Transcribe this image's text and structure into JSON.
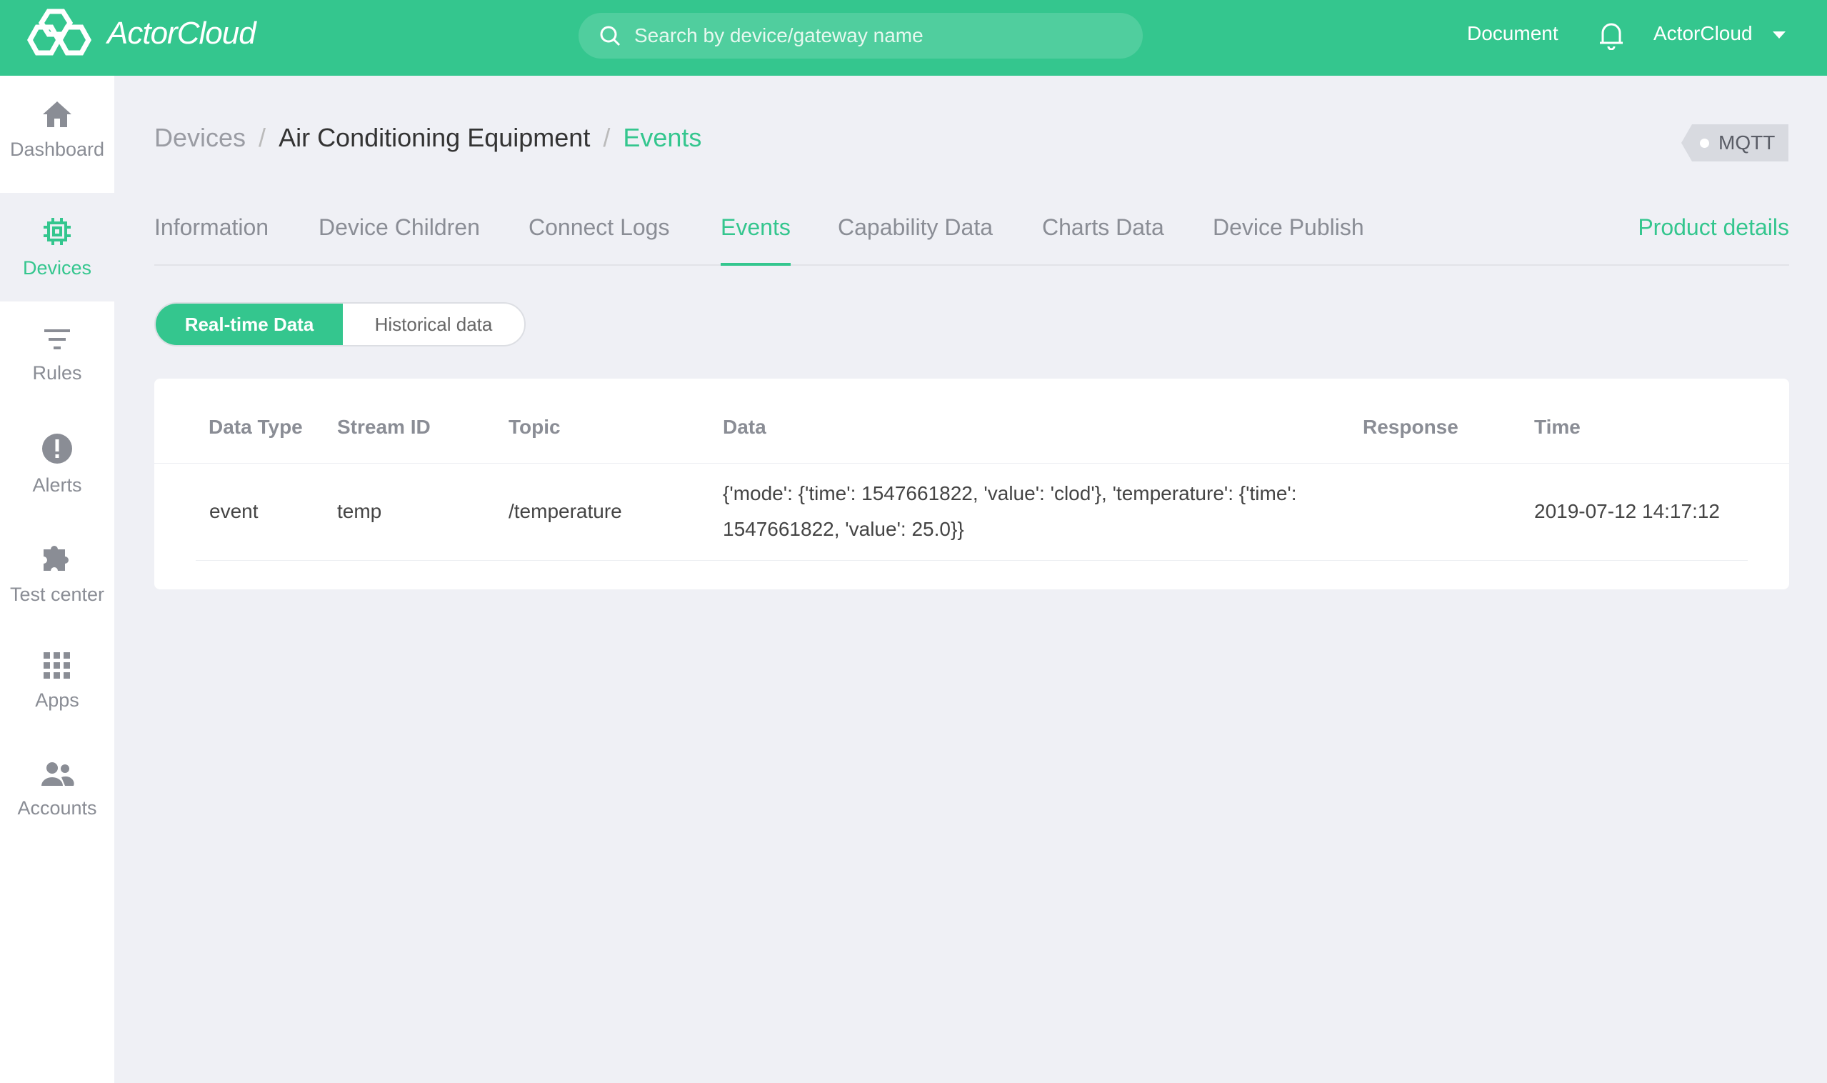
{
  "header": {
    "logo_text": "ActorCloud",
    "search_placeholder": "Search by device/gateway name",
    "document": "Document",
    "user": "ActorCloud"
  },
  "sidebar": {
    "items": [
      {
        "label": "Dashboard",
        "icon": "home-icon"
      },
      {
        "label": "Devices",
        "icon": "chip-icon",
        "active": true
      },
      {
        "label": "Rules",
        "icon": "filter-icon"
      },
      {
        "label": "Alerts",
        "icon": "alert-icon"
      },
      {
        "label": "Test center",
        "icon": "puzzle-icon"
      },
      {
        "label": "Apps",
        "icon": "grid-icon"
      },
      {
        "label": "Accounts",
        "icon": "users-icon"
      }
    ]
  },
  "breadcrumb": [
    "Devices",
    "Air Conditioning Equipment",
    "Events"
  ],
  "protocol_tag": "MQTT",
  "tabs": [
    "Information",
    "Device Children",
    "Connect Logs",
    "Events",
    "Capability Data",
    "Charts Data",
    "Device Publish"
  ],
  "active_tab": "Events",
  "product_details": "Product details",
  "toggle": {
    "realtime": "Real-time Data",
    "historical": "Historical data"
  },
  "table": {
    "headers": [
      "Data Type",
      "Stream ID",
      "Topic",
      "Data",
      "Response",
      "Time"
    ],
    "rows": [
      {
        "type": "event",
        "stream": "temp",
        "topic": "/temperature",
        "data_line1": "{'mode': {'time': 1547661822, 'value': 'clod'}, 'temperature': {'time':",
        "data_line2": "1547661822, 'value': 25.0}}",
        "response": "",
        "time": "2019-07-12 14:17:12"
      }
    ]
  },
  "colors": {
    "brand": "#34c68e"
  }
}
